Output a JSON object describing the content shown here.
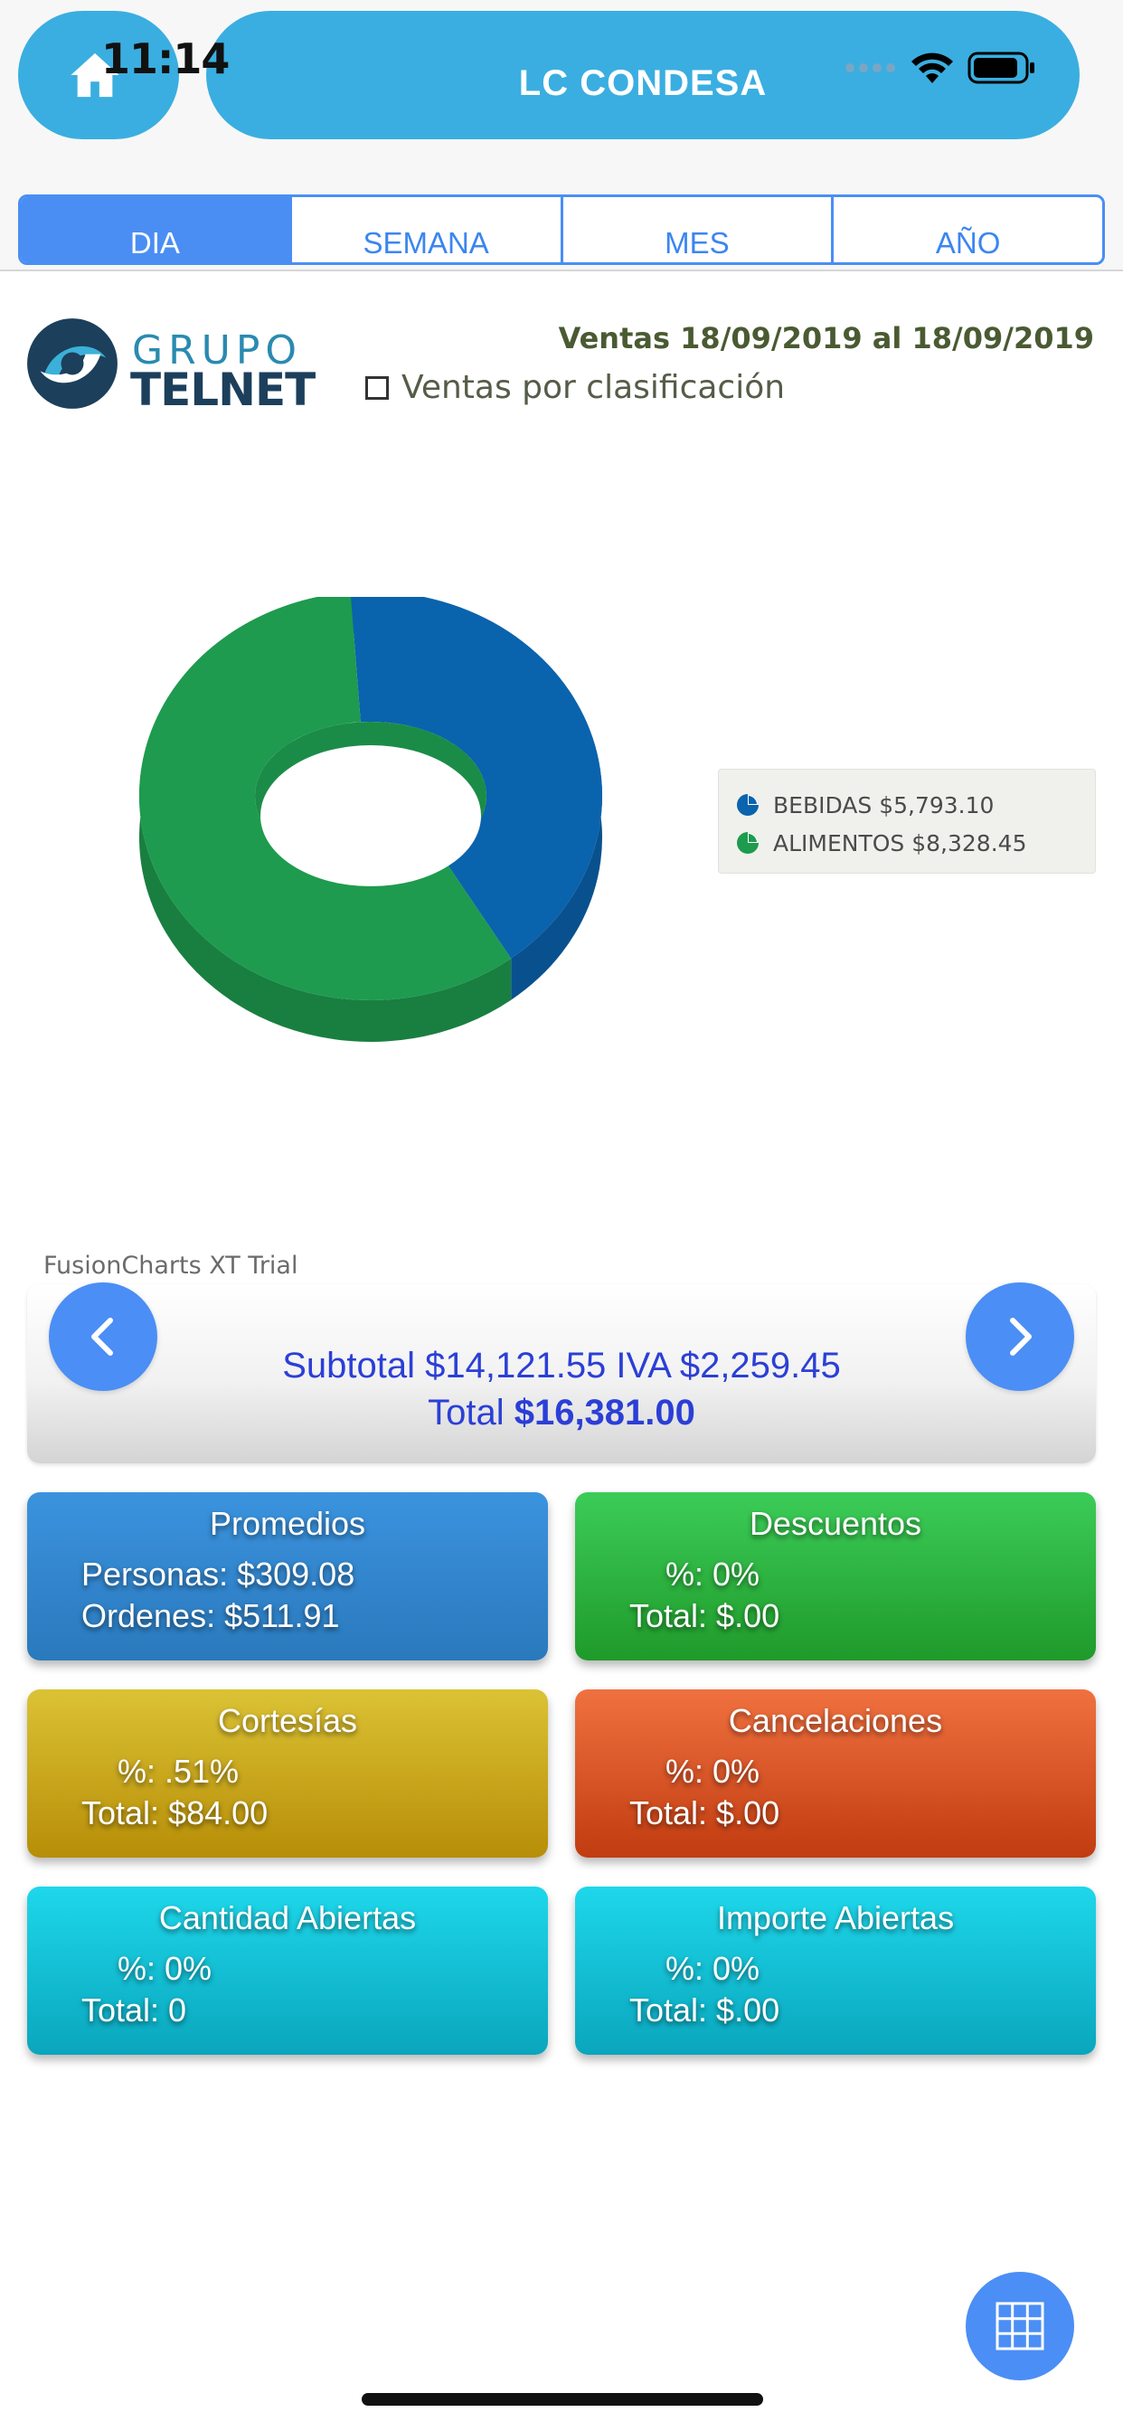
{
  "status": {
    "time": "11:14"
  },
  "header": {
    "title": "LC CONDESA"
  },
  "tabs": [
    {
      "label": "DIA",
      "active": true
    },
    {
      "label": "SEMANA",
      "active": false
    },
    {
      "label": "MES",
      "active": false
    },
    {
      "label": "AÑO",
      "active": false
    }
  ],
  "logo": {
    "grupo": "GRUPO",
    "telnet": "TELNET",
    "trademark": "."
  },
  "report": {
    "range": "Ventas 18/09/2019 al 18/09/2019",
    "classification_label": "Ventas por clasificación",
    "classification_checked": false
  },
  "chart_data": {
    "type": "pie",
    "style": "doughnut-3d",
    "categories": [
      "BEBIDAS",
      "ALIMENTOS"
    ],
    "values": [
      5793.1,
      8328.45
    ],
    "labels": [
      "BEBIDAS $5,793.10",
      "ALIMENTOS $8,328.45"
    ],
    "colors": [
      "#0a63ad",
      "#1e9b4f"
    ],
    "legend": "right",
    "watermark": "FusionCharts XT Trial"
  },
  "totals": {
    "line1": "Subtotal $14,121.55 IVA $2,259.45",
    "total_label": "Total ",
    "total_value": "$16,381.00"
  },
  "cards": {
    "promedios": {
      "title": "Promedios",
      "l1": "Personas: $309.08",
      "l2": "Ordenes: $511.91",
      "color": "#3286cf"
    },
    "descuentos": {
      "title": "Descuentos",
      "l1": "%: 0%",
      "l2": "Total: $.00",
      "color": "#2eb542"
    },
    "cortesias": {
      "title": "Cortesías",
      "l1": "%: .51%",
      "l2": "Total: $84.00",
      "color": "#c9a81c"
    },
    "cancelaciones": {
      "title": "Cancelaciones",
      "l1": "%: 0%",
      "l2": "Total: $.00",
      "color": "#da5628"
    },
    "cantidad_abiertas": {
      "title": "Cantidad Abiertas",
      "l1": "%: 0%",
      "l2": "Total: 0",
      "color": "#14c2d6"
    },
    "importe_abiertas": {
      "title": "Importe Abiertas",
      "l1": "%: 0%",
      "l2": "Total: $.00",
      "color": "#14c2d6"
    }
  },
  "icons": {
    "home": "home-icon",
    "wifi": "wifi-icon",
    "battery": "battery-icon",
    "prev": "chevron-left-icon",
    "next": "chevron-right-icon",
    "grid": "grid-icon"
  }
}
